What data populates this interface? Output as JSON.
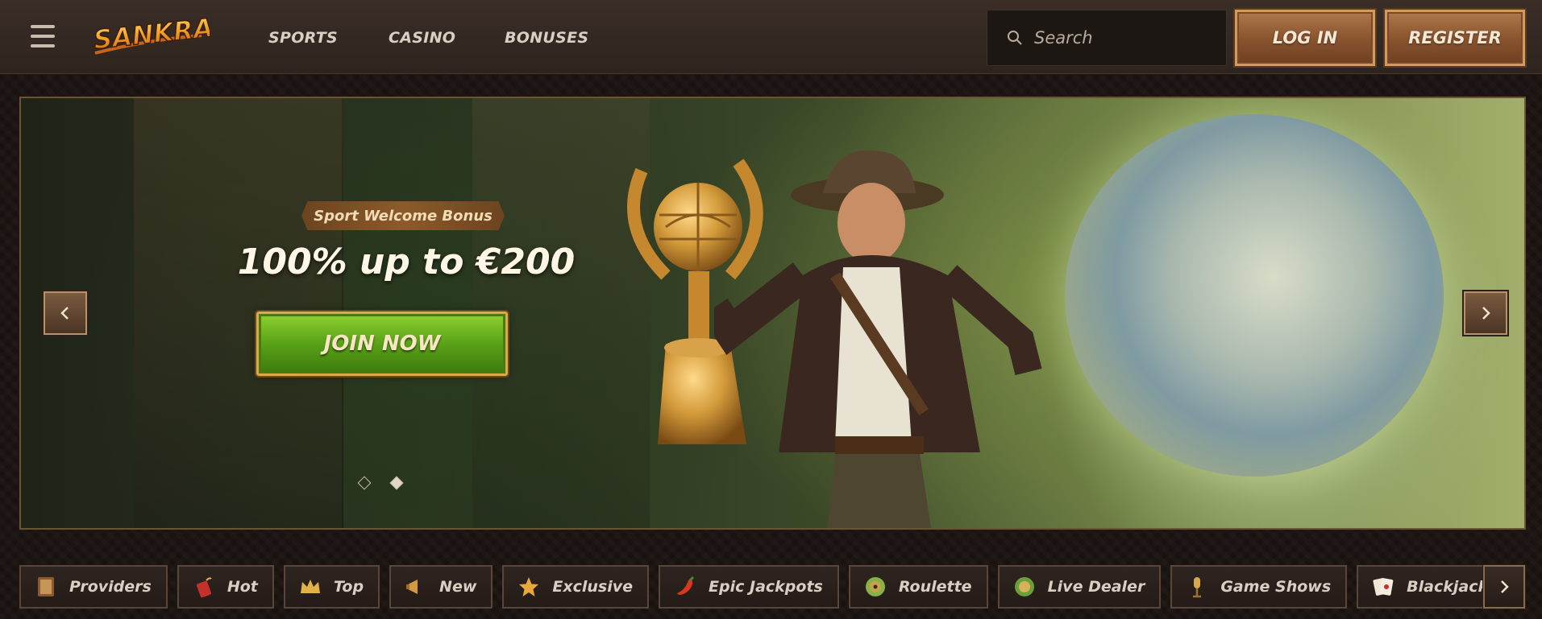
{
  "header": {
    "logo_text": "SANKRA",
    "nav": [
      "SPORTS",
      "CASINO",
      "BONUSES"
    ],
    "search_placeholder": "Search",
    "login_label": "LOG IN",
    "register_label": "REGISTER"
  },
  "banner": {
    "tag": "Sport Welcome Bonus",
    "headline": "100% up to €200",
    "cta_label": "JOIN NOW",
    "slides_total": 2,
    "active_slide": 2
  },
  "categories": [
    {
      "label": "Providers",
      "icon": "book-icon"
    },
    {
      "label": "Hot",
      "icon": "dynamite-icon"
    },
    {
      "label": "Top",
      "icon": "crown-icon"
    },
    {
      "label": "New",
      "icon": "megaphone-icon"
    },
    {
      "label": "Exclusive",
      "icon": "star-icon"
    },
    {
      "label": "Epic Jackpots",
      "icon": "chili-icon"
    },
    {
      "label": "Roulette",
      "icon": "roulette-icon"
    },
    {
      "label": "Live Dealer",
      "icon": "chip-icon"
    },
    {
      "label": "Game Shows",
      "icon": "microphone-icon"
    },
    {
      "label": "Blackjack",
      "icon": "cards-icon"
    }
  ],
  "colors": {
    "background": "#1c1512",
    "header": "#2e241e",
    "accent_brown": "#8a5530",
    "cta_green": "#5aa218",
    "text": "#d9cfc2"
  }
}
